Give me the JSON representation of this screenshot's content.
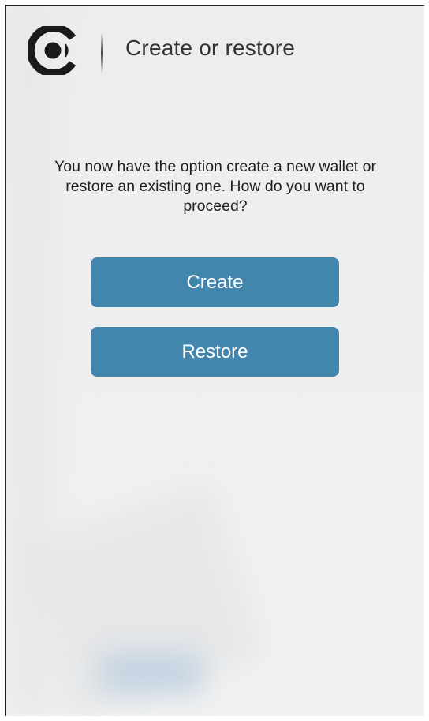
{
  "header": {
    "logo_icon": "wallet-logo-icon",
    "title": "Create or restore"
  },
  "main": {
    "message": "You now have the option create a new wallet or restore an existing one. How do you want to proceed?",
    "create_label": "Create",
    "restore_label": "Restore"
  },
  "colors": {
    "accent": "#4285ad",
    "text": "#333333",
    "background": "#eeefef"
  }
}
